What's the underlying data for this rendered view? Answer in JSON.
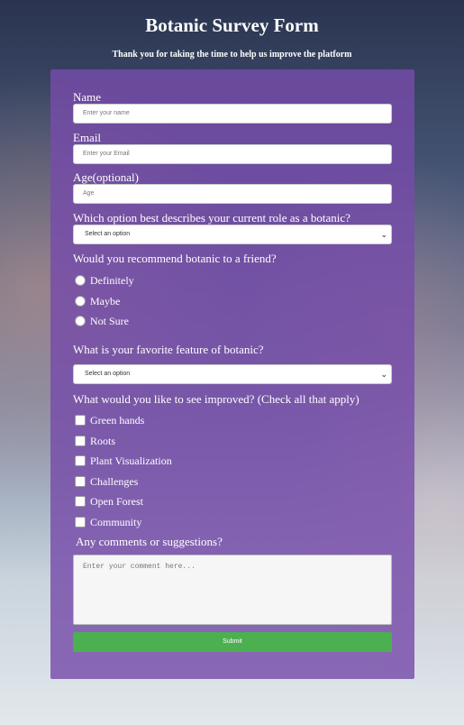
{
  "header": {
    "title": "Botanic Survey Form",
    "subtitle": "Thank you for taking the time to help us improve the platform"
  },
  "form": {
    "name": {
      "label": "Name",
      "placeholder": "Enter your name"
    },
    "email": {
      "label": "Email",
      "placeholder": "Enter your Email"
    },
    "age": {
      "label": "Age(optional)",
      "placeholder": "Age"
    },
    "role": {
      "label": "Which option best describes your current role as a botanic?",
      "selected": "Select an option"
    },
    "recommend": {
      "label": "Would you recommend botanic to a friend?",
      "options": [
        "Definitely",
        "Maybe",
        "Not Sure"
      ]
    },
    "favorite": {
      "label": "What is your favorite feature of botanic?",
      "selected": "Select an option"
    },
    "improve": {
      "label": "What would you like to see improved? (Check all that apply)",
      "options": [
        "Green hands",
        "Roots",
        "Plant Visualization",
        "Challenges",
        "Open Forest",
        "Community"
      ]
    },
    "comments": {
      "label": "Any comments or suggestions?",
      "placeholder": "Enter your comment here..."
    },
    "submit_label": "Submit"
  }
}
